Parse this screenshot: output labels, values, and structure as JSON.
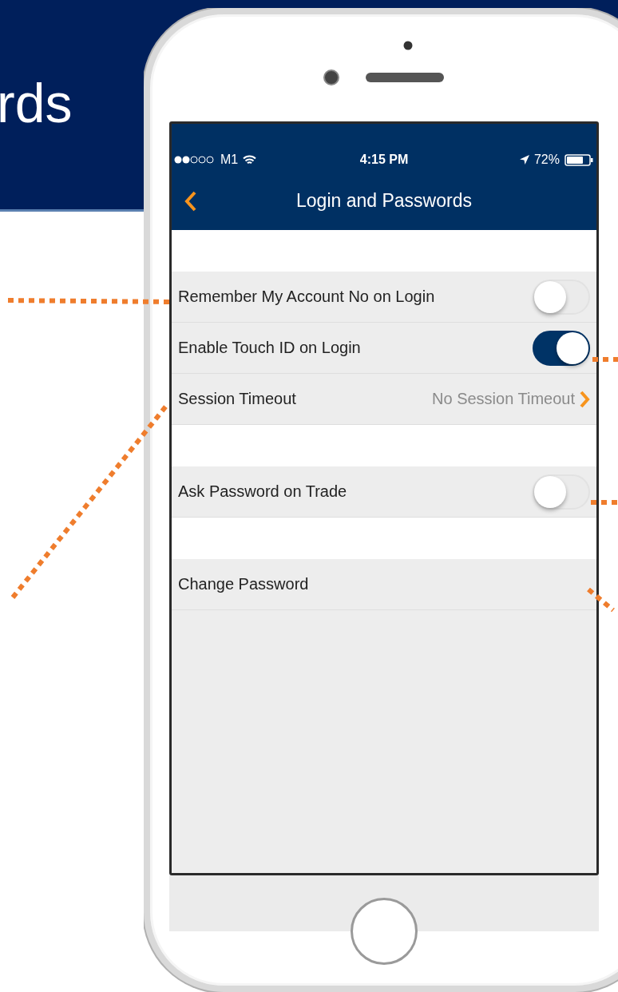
{
  "banner": {
    "heading": "rds"
  },
  "status_bar": {
    "carrier": "M1",
    "time": "4:15 PM",
    "battery": "72%"
  },
  "nav_bar": {
    "title": "Login and Passwords"
  },
  "sections": [
    {
      "rows": [
        {
          "kind": "toggle",
          "label": "Remember My Account No on Login",
          "on": false
        },
        {
          "kind": "toggle",
          "label": "Enable Touch ID on Login",
          "on": true
        },
        {
          "kind": "disclosure",
          "label": "Session Timeout",
          "value": "No Session Timeout"
        }
      ]
    },
    {
      "rows": [
        {
          "kind": "toggle",
          "label": "Ask Password on Trade",
          "on": false
        }
      ]
    },
    {
      "rows": [
        {
          "kind": "plain",
          "label": "Change Password"
        }
      ]
    }
  ]
}
